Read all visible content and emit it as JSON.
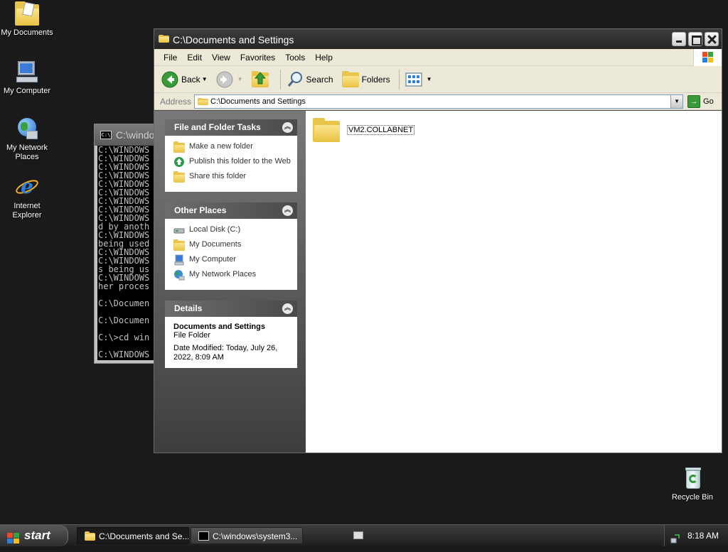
{
  "desktop": {
    "icons": [
      {
        "label": "My Documents"
      },
      {
        "label": "My Computer"
      },
      {
        "label": "My Network Places"
      },
      {
        "label": "Internet Explorer"
      },
      {
        "label": "Recycle Bin"
      }
    ]
  },
  "console": {
    "title": "C:\\windo",
    "icon_text": "C:\\",
    "lines": [
      "C:\\WINDOWS",
      "C:\\WINDOWS",
      "C:\\WINDOWS",
      "C:\\WINDOWS",
      "C:\\WINDOWS",
      "C:\\WINDOWS",
      "C:\\WINDOWS",
      "C:\\WINDOWS",
      "C:\\WINDOWS",
      "d by anoth",
      "C:\\WINDOWS",
      "being used",
      "C:\\WINDOWS",
      "C:\\WINDOWS",
      "s being us",
      "C:\\WINDOWS",
      "her proces",
      "",
      "C:\\Documen",
      "",
      "C:\\Documen",
      "",
      "C:\\>cd win",
      "",
      "C:\\WINDOWS"
    ]
  },
  "explorer": {
    "title": "C:\\Documents and Settings",
    "menu": [
      "File",
      "Edit",
      "View",
      "Favorites",
      "Tools",
      "Help"
    ],
    "toolbar": {
      "back_label": "Back",
      "search_label": "Search",
      "folders_label": "Folders"
    },
    "address": {
      "label": "Address",
      "value": "C:\\Documents and Settings",
      "go_label": "Go"
    },
    "tasks": {
      "file_folder": {
        "header": "File and Folder Tasks",
        "links": [
          "Make a new folder",
          "Publish this folder to the Web",
          "Share this folder"
        ]
      },
      "other_places": {
        "header": "Other Places",
        "links": [
          "Local Disk (C:)",
          "My Documents",
          "My Computer",
          "My Network Places"
        ]
      },
      "details": {
        "header": "Details",
        "name": "Documents and Settings",
        "type": "File Folder",
        "modified": "Date Modified: Today, July 26, 2022, 8:09 AM"
      }
    },
    "files": [
      {
        "name": "VM2.COLLABNET"
      }
    ]
  },
  "taskbar": {
    "start_label": "start",
    "tasks": [
      {
        "label": "C:\\Documents and Se..."
      },
      {
        "label": "C:\\windows\\system3..."
      }
    ],
    "clock": "8:18 AM"
  },
  "colors": {
    "desktop_bg": "#1a1a1a",
    "folder_yellow": "#e8c54a",
    "go_green": "#3a9a3a"
  }
}
